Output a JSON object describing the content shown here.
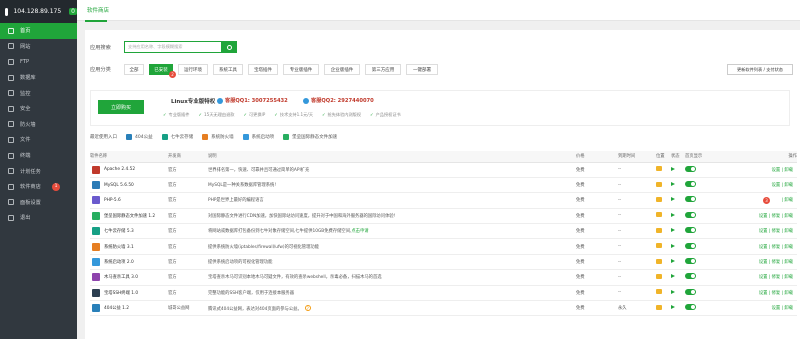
{
  "sidebar": {
    "server_ip": "104.128.89.175",
    "update_count": "0",
    "items": [
      {
        "label": "首页",
        "icon": "home-icon"
      },
      {
        "label": "网站",
        "icon": "globe-icon"
      },
      {
        "label": "FTP",
        "icon": "ftp-icon"
      },
      {
        "label": "数据库",
        "icon": "database-icon"
      },
      {
        "label": "监控",
        "icon": "monitor-icon"
      },
      {
        "label": "安全",
        "icon": "shield-icon"
      },
      {
        "label": "防火墙",
        "icon": "firewall-icon"
      },
      {
        "label": "文件",
        "icon": "folder-icon"
      },
      {
        "label": "终端",
        "icon": "terminal-icon"
      },
      {
        "label": "计划任务",
        "icon": "clock-icon"
      },
      {
        "label": "软件商店",
        "icon": "store-icon",
        "badge": "1"
      },
      {
        "label": "面板设置",
        "icon": "gear-icon"
      },
      {
        "label": "退出",
        "icon": "logout-icon"
      }
    ]
  },
  "header": {
    "tab": "软件商店"
  },
  "search": {
    "label": "应用搜索",
    "placeholder": "支持应用名称、字段模糊搜索"
  },
  "category": {
    "label": "应用分类",
    "items": [
      "全部",
      "已安装",
      "运行环境",
      "系统工具",
      "宝塔插件",
      "专业版插件",
      "企业版插件",
      "第三方应用",
      "一键部署"
    ],
    "selected_badge": "2"
  },
  "update_button": "更新软件列表 / 支付状态",
  "pro": {
    "buy": "立即购买",
    "title": "Linux专业版特权",
    "qq1": "客服QQ1: 3007255432",
    "qq2": "客服QQ2: 2927440070",
    "features": [
      "专业版插件",
      "15天无理由退款",
      "可更换IP",
      "技术支持1.1元/天",
      "抢先体验内测版权",
      "产品授权证书"
    ]
  },
  "recent": {
    "label": "最近使用入口",
    "items": [
      "404公益",
      "七牛云存储",
      "系统防火墙",
      "系统启动项",
      "堡垒国际静态文件加速"
    ]
  },
  "table": {
    "headers": [
      "软件名称",
      "开发商",
      "说明",
      "价格",
      "到期时间",
      "位置",
      "状态",
      "首页显示",
      "操作"
    ],
    "rows": [
      {
        "name": "Apache 2.4.52",
        "dev": "官方",
        "desc": "世界排名第一，快速、可靠并且可通过简单的API扩充",
        "price": "免费",
        "expire": "--",
        "ops": "设置 | 卸载",
        "icon": "#c0392b"
      },
      {
        "name": "MySQL 5.6.50",
        "dev": "官方",
        "desc": "MySQL是一种关系数据库管理系统!",
        "price": "免费",
        "expire": "--",
        "ops": "设置 | 卸载",
        "icon": "#2c7bb6"
      },
      {
        "name": "PHP-5.6",
        "dev": "官方",
        "desc": "PHP是世界上最好的编程语言",
        "price": "免费",
        "expire": "--",
        "ops": "| 卸载",
        "icon": "#6a5acd",
        "badge": "3"
      },
      {
        "name": "堡垒国际静态文件加速 1.2",
        "dev": "官方",
        "desc": "对国际静态文件进行CDN加速，加快国际站访问速度，提升对于中国和海外服务器的国际访问体验!",
        "price": "免费",
        "expire": "--",
        "ops": "设置 | 修复 | 卸载",
        "icon": "#27ae60"
      },
      {
        "name": "七牛云存储 5.3",
        "dev": "官方",
        "desc": "将网站或数据库打包备份到七牛对象存储空间,七牛提供10GB免费存储空间,",
        "link": "点击申请",
        "price": "免费",
        "expire": "--",
        "ops": "设置 | 修复 | 卸载",
        "icon": "#16a085"
      },
      {
        "name": "系统防火墙 3.1",
        "dev": "官方",
        "desc": "提供系统防火墙(iptables/firewall/ufw)的可视化管理功能",
        "price": "免费",
        "expire": "--",
        "ops": "设置 | 修复 | 卸载",
        "icon": "#e67e22"
      },
      {
        "name": "系统启动项 2.0",
        "dev": "官方",
        "desc": "提供系统启动项的可视化管理功能",
        "price": "免费",
        "expire": "--",
        "ops": "设置 | 修复 | 卸载",
        "icon": "#3498db"
      },
      {
        "name": "木马查杀工具 3.0",
        "dev": "官方",
        "desc": "宝塔查杀木马可识别本地木马可疑文件，有效的查杀webshell，杀毒必备，扫描木马的首选",
        "price": "免费",
        "expire": "--",
        "ops": "设置 | 修复 | 卸载",
        "icon": "#8e44ad"
      },
      {
        "name": "宝塔SSH终端 1.0",
        "dev": "官方",
        "desc": "完整功能的SSH客户端，仅用于连接本服务器",
        "price": "免费",
        "expire": "--",
        "ops": "设置 | 修复 | 卸载",
        "icon": "#2c3e50"
      },
      {
        "name": "404公益 1.2",
        "dev": "城哥公益网",
        "desc": "腾讯式404公益网，表达对404页面的参与公益。",
        "price": "免费",
        "expire": "永久",
        "ops": "设置 | 卸载",
        "icon": "#2980b9",
        "help": "?"
      }
    ]
  },
  "colors": {
    "brand": "#20a53a",
    "sidebar": "#31383f",
    "badge": "#e74c3c"
  }
}
